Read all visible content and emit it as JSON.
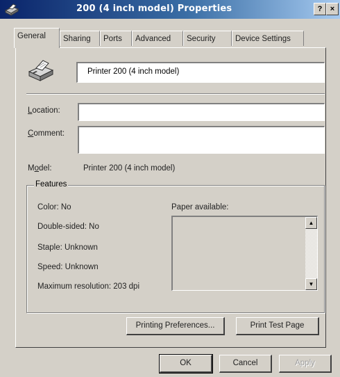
{
  "window": {
    "title": "200 (4 inch model) Properties",
    "help_glyph": "?",
    "close_glyph": "×"
  },
  "tabs": [
    {
      "label": "General",
      "active": true
    },
    {
      "label": "Sharing"
    },
    {
      "label": "Ports"
    },
    {
      "label": "Advanced"
    },
    {
      "label": "Security"
    },
    {
      "label": "Device Settings"
    }
  ],
  "general": {
    "printer_name": "Printer 200 (4 inch model)",
    "location_label": "Location:",
    "location_value": "",
    "comment_label": "Comment:",
    "comment_value": "",
    "model_label": "Model:",
    "model_value": "Printer 200 (4 inch model)"
  },
  "features": {
    "group_label": "Features",
    "color": "Color: No",
    "double_sided": "Double-sided: No",
    "staple": "Staple: Unknown",
    "speed": "Speed: Unknown",
    "max_resolution": "Maximum resolution: 203 dpi",
    "paper_available_label": "Paper available:",
    "paper_items": []
  },
  "buttons": {
    "printing_preferences": "Printing Preferences...",
    "print_test_page": "Print Test Page",
    "ok": "OK",
    "cancel": "Cancel",
    "apply": "Apply"
  },
  "colors": {
    "titlebar_start": "#0a246a",
    "titlebar_end": "#a6caf0",
    "face": "#d4d0c8"
  },
  "icons": {
    "title": "printer-icon",
    "main": "printer-icon"
  }
}
